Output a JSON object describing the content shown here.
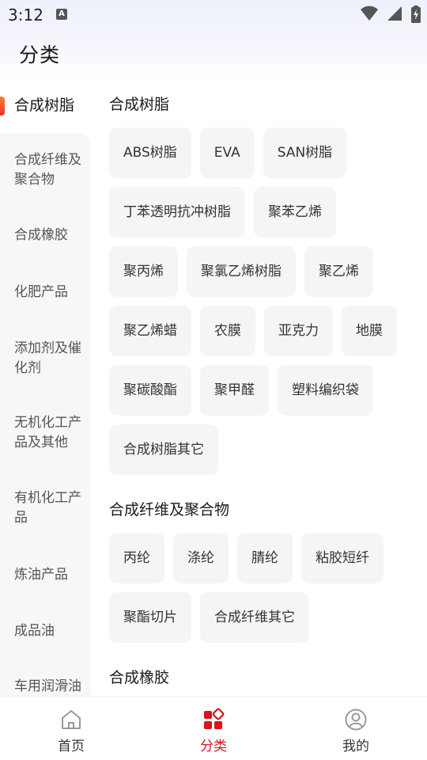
{
  "status_bar": {
    "time": "3:12",
    "notification_icon": "a-icon"
  },
  "header": {
    "title": "分类"
  },
  "sidebar": {
    "items": [
      {
        "label": "合成树脂",
        "active": true
      },
      {
        "label": "合成纤维及聚合物"
      },
      {
        "label": "合成橡胶"
      },
      {
        "label": "化肥产品"
      },
      {
        "label": "添加剂及催化剂"
      },
      {
        "label": "无机化工产品及其他"
      },
      {
        "label": "有机化工产品"
      },
      {
        "label": "炼油产品"
      },
      {
        "label": "成品油"
      },
      {
        "label": "车用润滑油"
      }
    ]
  },
  "sections": [
    {
      "title": "合成树脂",
      "items": [
        "ABS树脂",
        "EVA",
        "SAN树脂",
        "丁苯透明抗冲树脂",
        "聚苯乙烯",
        "聚丙烯",
        "聚氯乙烯树脂",
        "聚乙烯",
        "聚乙烯蜡",
        "农膜",
        "亚克力",
        "地膜",
        "聚碳酸酯",
        "聚甲醛",
        "塑料编织袋",
        "合成树脂其它"
      ]
    },
    {
      "title": "合成纤维及聚合物",
      "items": [
        "丙纶",
        "涤纶",
        "腈纶",
        "粘胶短纤",
        "聚酯切片",
        "合成纤维其它"
      ]
    },
    {
      "title": "合成橡胶",
      "items": []
    }
  ],
  "bottom_nav": {
    "items": [
      {
        "label": "首页",
        "icon": "home-icon",
        "active": false
      },
      {
        "label": "分类",
        "icon": "category-icon",
        "active": true
      },
      {
        "label": "我的",
        "icon": "profile-icon",
        "active": false
      }
    ]
  },
  "colors": {
    "accent": "#d8141c",
    "indicator_start": "#ff7a2f",
    "indicator_end": "#e8322a"
  }
}
